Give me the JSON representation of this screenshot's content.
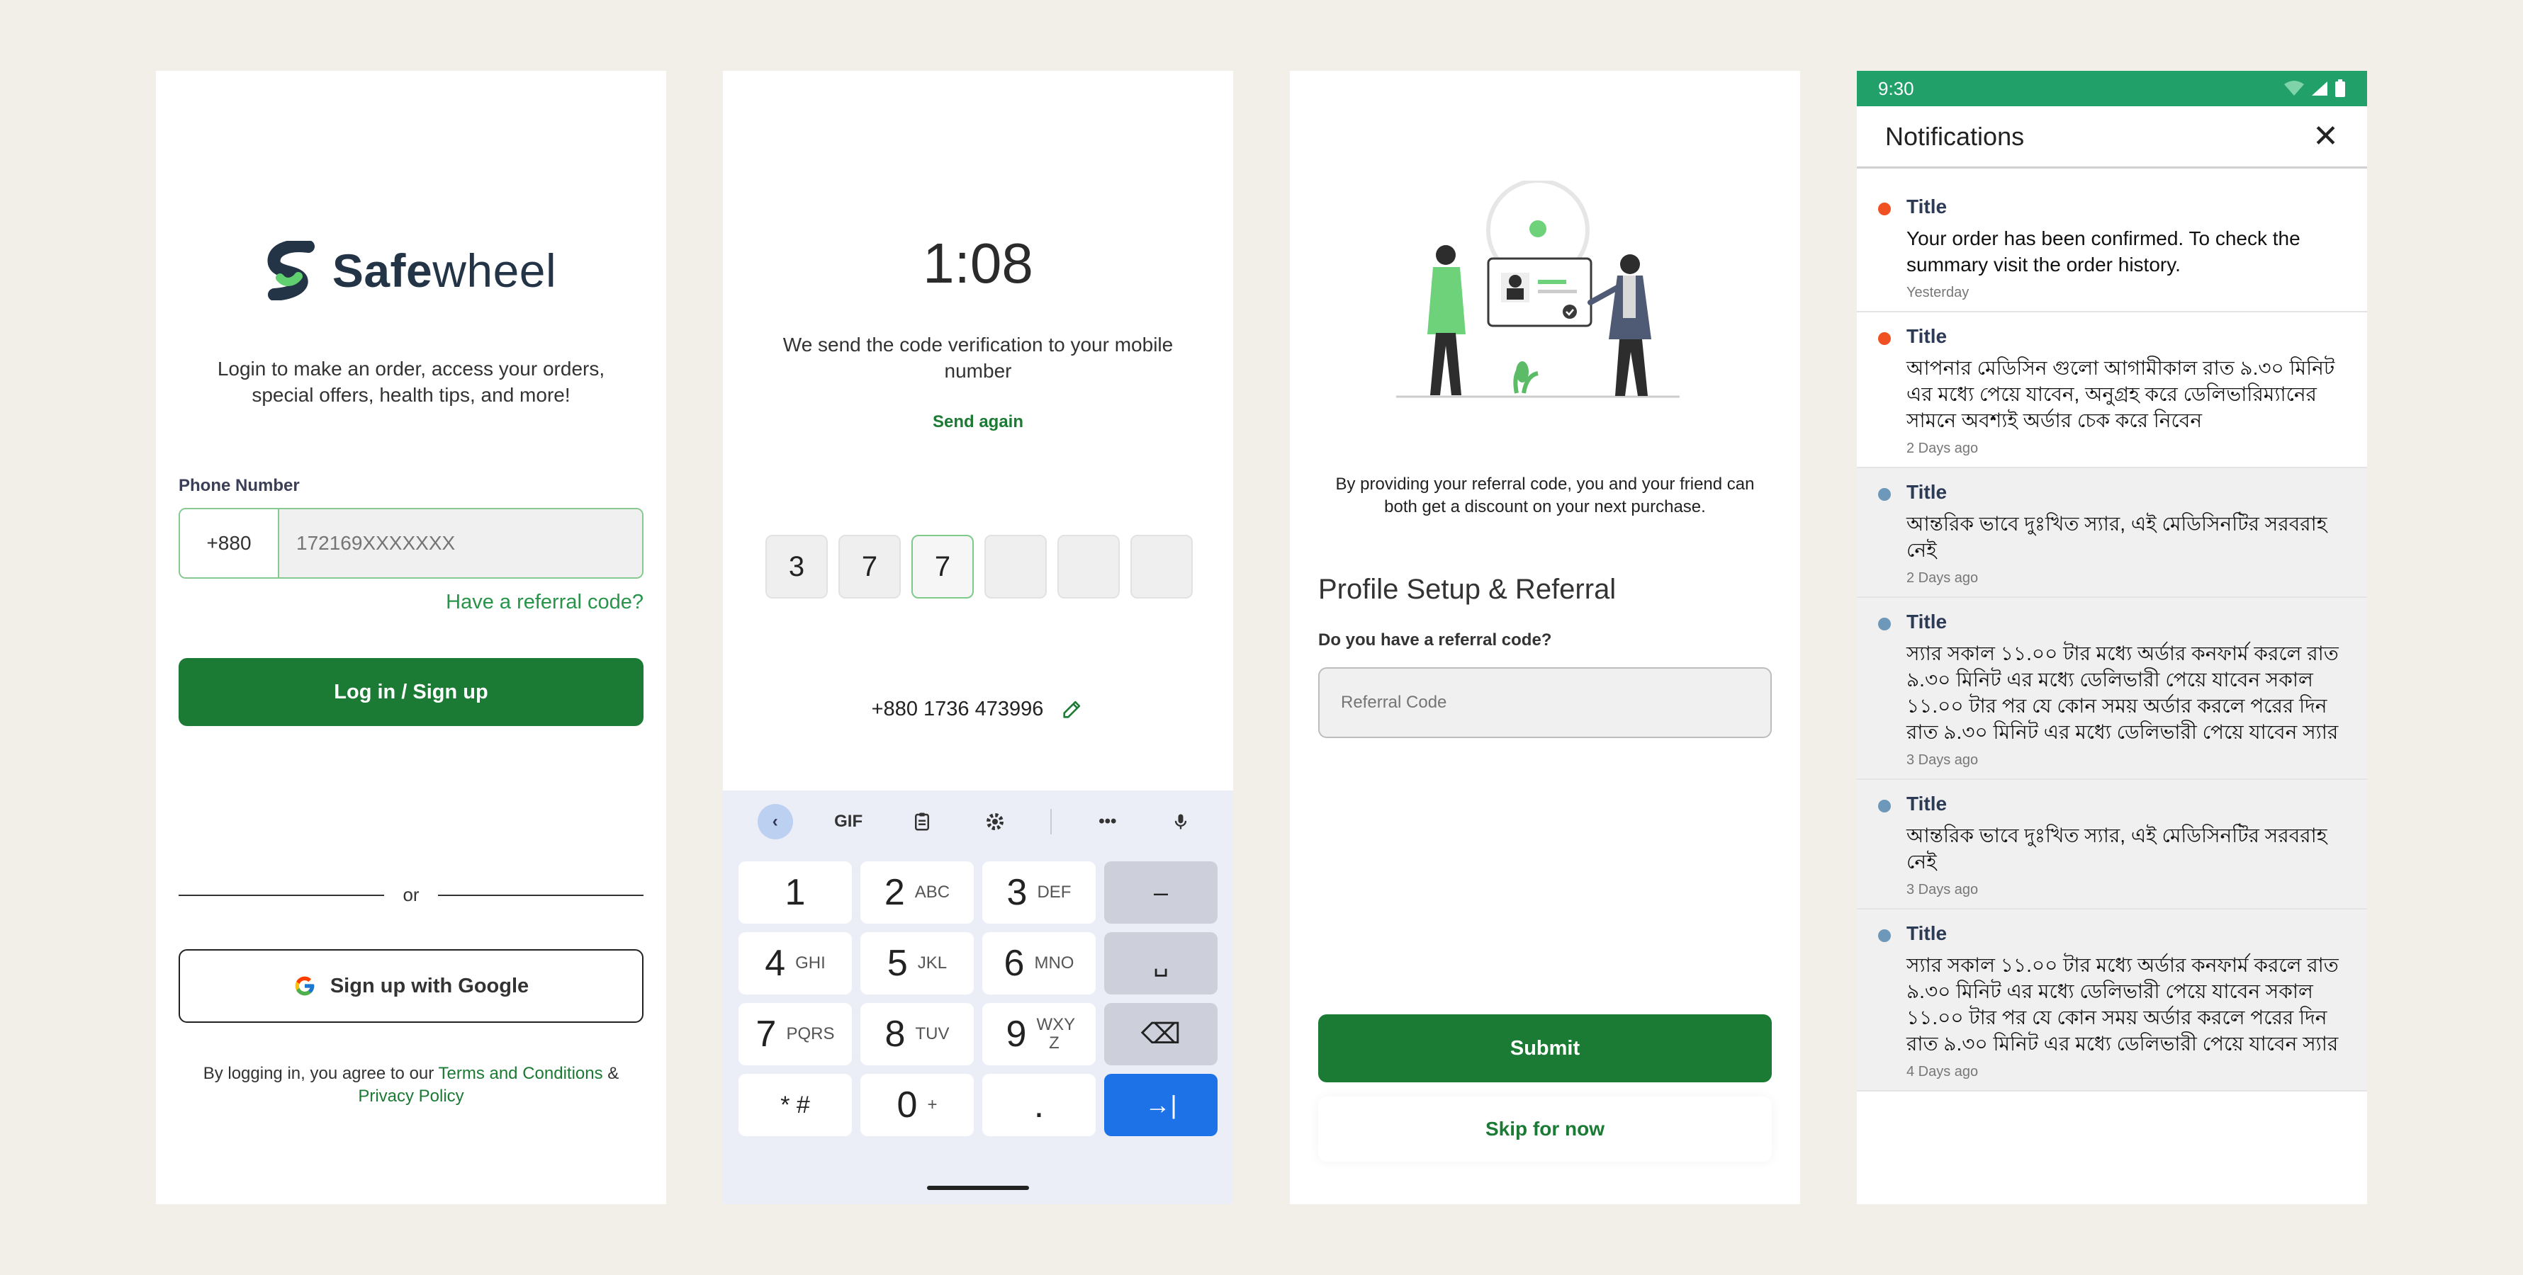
{
  "login": {
    "brand_bold": "Safe",
    "brand_light": "wheel",
    "intro": "Login to make an order, access your orders, special offers, health tips, and more!",
    "phone_label": "Phone Number",
    "country_code": "+880",
    "phone_placeholder": "172169XXXXXXX",
    "referral_link": "Have a referral code?",
    "login_button": "Log in / Sign up",
    "or_text": "or",
    "google_button": "Sign up with Google",
    "terms_prefix": "By logging in, you agree to our ",
    "terms_link": "Terms and Conditions",
    "terms_amp": " &",
    "privacy_link": "Privacy Policy",
    "brand_color": "#1b7a33"
  },
  "otp": {
    "timer": "1:08",
    "subtitle": "We send the code verification to your mobile number",
    "send_again": "Send again",
    "digits": [
      "3",
      "7",
      "7",
      "",
      "",
      ""
    ],
    "phone": "+880 1736 473996",
    "keyboard": {
      "toolbar": [
        "back-icon",
        "GIF",
        "clipboard-icon",
        "gear-icon",
        "more-icon",
        "mic-icon"
      ],
      "gif": "GIF",
      "more": "•••",
      "keys": [
        {
          "num": "1",
          "sub": ""
        },
        {
          "num": "2",
          "sub": "ABC"
        },
        {
          "num": "3",
          "sub": "DEF"
        },
        {
          "num": "–",
          "sub": ""
        },
        {
          "num": "4",
          "sub": "GHI"
        },
        {
          "num": "5",
          "sub": "JKL"
        },
        {
          "num": "6",
          "sub": "MNO"
        },
        {
          "num": "␣",
          "sub": ""
        },
        {
          "num": "7",
          "sub": "PQRS"
        },
        {
          "num": "8",
          "sub": "TUV"
        },
        {
          "num": "9",
          "sub": "WXY Z"
        },
        {
          "num": "⌫",
          "sub": ""
        },
        {
          "num": "* #",
          "sub": ""
        },
        {
          "num": "0",
          "sub": "+"
        },
        {
          "num": ".",
          "sub": ""
        },
        {
          "num": "→|",
          "sub": ""
        }
      ]
    }
  },
  "referral": {
    "description": "By providing your referral code, you and your friend can both get a discount on your next purchase.",
    "title": "Profile Setup & Referral",
    "question": "Do you have a referral code?",
    "input_placeholder": "Referral Code",
    "submit": "Submit",
    "skip": "Skip for now"
  },
  "notifications": {
    "time": "9:30",
    "header": "Notifications",
    "close": "✕",
    "status_color": "#21a06a",
    "items": [
      {
        "title": "Title",
        "body": "Your order has been confirmed. To check the summary visit the order history.",
        "time": "Yesterday",
        "unread": true
      },
      {
        "title": "Title",
        "body": "আপনার মেডিসিন গুলো আগামীকাল রাত ৯.৩০ মিনিট এর মধ্যে পেয়ে যাবেন, অনুগ্রহ করে ডেলিভারিম্যানের সামনে অবশ্যই অর্ডার চেক করে নিবেন",
        "time": "2 Days ago",
        "unread": true
      },
      {
        "title": "Title",
        "body": "আন্তরিক ভাবে দুঃখিত স্যার, এই মেডিসিনটির সরবরাহ নেই",
        "time": "2 Days ago",
        "unread": false
      },
      {
        "title": "Title",
        "body": "স্যার সকাল ১১.০০ টার মধ্যে অর্ডার কনফার্ম করলে রাত ৯.৩০ মিনিট এর মধ্যে ডেলিভারী পেয়ে যাবেন   সকাল ১১.০০ টার পর যে কোন সময় অর্ডার করলে পরের দিন রাত ৯.৩০ মিনিট এর মধ্যে ডেলিভারী পেয়ে যাবেন স্যার",
        "time": "3 Days ago",
        "unread": false
      },
      {
        "title": "Title",
        "body": "আন্তরিক ভাবে দুঃখিত স্যার, এই মেডিসিনটির সরবরাহ নেই",
        "time": "3 Days ago",
        "unread": false
      },
      {
        "title": "Title",
        "body": "স্যার সকাল ১১.০০ টার মধ্যে অর্ডার কনফার্ম করলে রাত ৯.৩০ মিনিট এর মধ্যে ডেলিভারী পেয়ে যাবেন   সকাল ১১.০০ টার পর যে কোন সময় অর্ডার করলে পরের দিন রাত ৯.৩০ মিনিট এর মধ্যে ডেলিভারী পেয়ে যাবেন স্যার",
        "time": "4 Days ago",
        "unread": false
      }
    ]
  }
}
